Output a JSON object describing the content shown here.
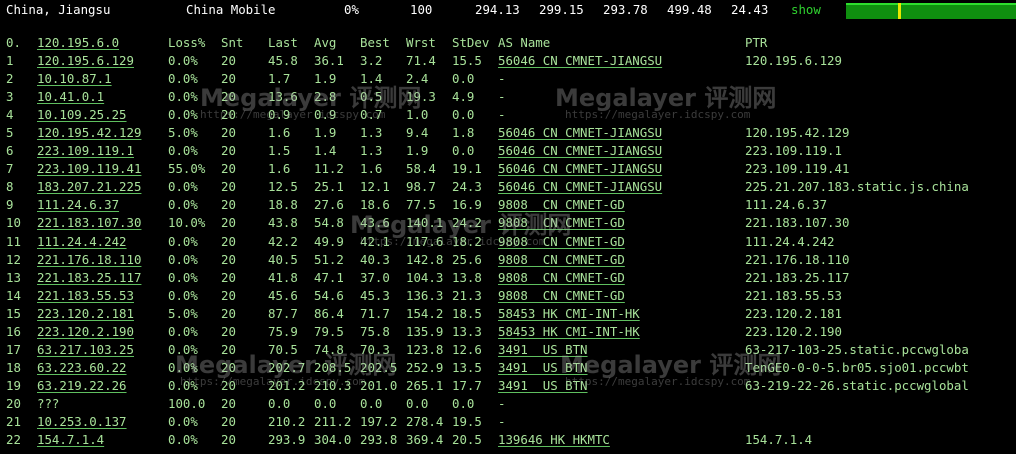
{
  "header": {
    "location": "China, Jiangsu",
    "isp": "China Mobile",
    "loss": "0%",
    "sent": "100",
    "last": "294.13",
    "avg": "299.15",
    "best": "293.78",
    "worst": "499.48",
    "stdev": "24.43",
    "show_label": "show",
    "bar_color": "#0f8f0f",
    "bar_spike_color": "#e8e800"
  },
  "columns": {
    "idx": "0.",
    "host": "120.195.6.0",
    "loss": "Loss%",
    "snt": "Snt",
    "last": "Last",
    "avg": "Avg",
    "best": "Best",
    "wrst": "Wrst",
    "stdev": "StDev",
    "as": "AS Name",
    "ptr": "PTR"
  },
  "rows": [
    {
      "n": "1",
      "host": "120.195.6.129",
      "loss": "0.0%",
      "snt": "20",
      "last": "45.8",
      "avg": "36.1",
      "best": "3.2",
      "wrst": "71.4",
      "stdev": "15.5",
      "as": "56046 CN CMNET-JIANGSU",
      "ptr": "120.195.6.129"
    },
    {
      "n": "2",
      "host": "10.10.87.1",
      "loss": "0.0%",
      "snt": "20",
      "last": "1.7",
      "avg": "1.9",
      "best": "1.4",
      "wrst": "2.4",
      "stdev": "0.0",
      "as": "-",
      "ptr": ""
    },
    {
      "n": "3",
      "host": "10.41.0.1",
      "loss": "0.0%",
      "snt": "20",
      "last": "13.6",
      "avg": "2.8",
      "best": "0.5",
      "wrst": "19.3",
      "stdev": "4.9",
      "as": "-",
      "ptr": ""
    },
    {
      "n": "4",
      "host": "10.109.25.25",
      "loss": "0.0%",
      "snt": "20",
      "last": "0.9",
      "avg": "0.9",
      "best": "0.7",
      "wrst": "1.0",
      "stdev": "0.0",
      "as": "-",
      "ptr": ""
    },
    {
      "n": "5",
      "host": "120.195.42.129",
      "loss": "5.0%",
      "snt": "20",
      "last": "1.6",
      "avg": "1.9",
      "best": "1.3",
      "wrst": "9.4",
      "stdev": "1.8",
      "as": "56046 CN CMNET-JIANGSU",
      "ptr": "120.195.42.129"
    },
    {
      "n": "6",
      "host": "223.109.119.1",
      "loss": "0.0%",
      "snt": "20",
      "last": "1.5",
      "avg": "1.4",
      "best": "1.3",
      "wrst": "1.9",
      "stdev": "0.0",
      "as": "56046 CN CMNET-JIANGSU",
      "ptr": "223.109.119.1"
    },
    {
      "n": "7",
      "host": "223.109.119.41",
      "loss": "55.0%",
      "snt": "20",
      "last": "1.6",
      "avg": "11.2",
      "best": "1.6",
      "wrst": "58.4",
      "stdev": "19.1",
      "as": "56046 CN CMNET-JIANGSU",
      "ptr": "223.109.119.41"
    },
    {
      "n": "8",
      "host": "183.207.21.225",
      "loss": "0.0%",
      "snt": "20",
      "last": "12.5",
      "avg": "25.1",
      "best": "12.1",
      "wrst": "98.7",
      "stdev": "24.3",
      "as": "56046 CN CMNET-JIANGSU",
      "ptr": "225.21.207.183.static.js.china"
    },
    {
      "n": "9",
      "host": "111.24.6.37",
      "loss": "0.0%",
      "snt": "20",
      "last": "18.8",
      "avg": "27.6",
      "best": "18.6",
      "wrst": "77.5",
      "stdev": "16.9",
      "as": "9808  CN CMNET-GD",
      "ptr": "111.24.6.37"
    },
    {
      "n": "10",
      "host": "221.183.107.30",
      "loss": "10.0%",
      "snt": "20",
      "last": "43.8",
      "avg": "54.8",
      "best": "43.6",
      "wrst": "140.1",
      "stdev": "24.2",
      "as": "9808  CN CMNET-GD",
      "ptr": "221.183.107.30"
    },
    {
      "n": "11",
      "host": "111.24.4.242",
      "loss": "0.0%",
      "snt": "20",
      "last": "42.2",
      "avg": "49.9",
      "best": "42.1",
      "wrst": "117.6",
      "stdev": "18.2",
      "as": "9808  CN CMNET-GD",
      "ptr": "111.24.4.242"
    },
    {
      "n": "12",
      "host": "221.176.18.110",
      "loss": "0.0%",
      "snt": "20",
      "last": "40.5",
      "avg": "51.2",
      "best": "40.3",
      "wrst": "142.8",
      "stdev": "25.6",
      "as": "9808  CN CMNET-GD",
      "ptr": "221.176.18.110"
    },
    {
      "n": "13",
      "host": "221.183.25.117",
      "loss": "0.0%",
      "snt": "20",
      "last": "41.8",
      "avg": "47.1",
      "best": "37.0",
      "wrst": "104.3",
      "stdev": "13.8",
      "as": "9808  CN CMNET-GD",
      "ptr": "221.183.25.117"
    },
    {
      "n": "14",
      "host": "221.183.55.53",
      "loss": "0.0%",
      "snt": "20",
      "last": "45.6",
      "avg": "54.6",
      "best": "45.3",
      "wrst": "136.3",
      "stdev": "21.3",
      "as": "9808  CN CMNET-GD",
      "ptr": "221.183.55.53"
    },
    {
      "n": "15",
      "host": "223.120.2.181",
      "loss": "5.0%",
      "snt": "20",
      "last": "87.7",
      "avg": "86.4",
      "best": "71.7",
      "wrst": "154.2",
      "stdev": "18.5",
      "as": "58453 HK CMI-INT-HK",
      "ptr": "223.120.2.181"
    },
    {
      "n": "16",
      "host": "223.120.2.190",
      "loss": "0.0%",
      "snt": "20",
      "last": "75.9",
      "avg": "79.5",
      "best": "75.8",
      "wrst": "135.9",
      "stdev": "13.3",
      "as": "58453 HK CMI-INT-HK",
      "ptr": "223.120.2.190"
    },
    {
      "n": "17",
      "host": "63.217.103.25",
      "loss": "0.0%",
      "snt": "20",
      "last": "70.5",
      "avg": "74.8",
      "best": "70.3",
      "wrst": "123.8",
      "stdev": "12.6",
      "as": "3491  US BTN",
      "ptr": "63-217-103-25.static.pccwgloba"
    },
    {
      "n": "18",
      "host": "63.223.60.22",
      "loss": "0.0%",
      "snt": "20",
      "last": "202.7",
      "avg": "208.5",
      "best": "202.5",
      "wrst": "252.9",
      "stdev": "13.5",
      "as": "3491  US BTN",
      "ptr": "TenGE0-0-0-5.br05.sjo01.pccwbt"
    },
    {
      "n": "19",
      "host": "63.219.22.26",
      "loss": "0.0%",
      "snt": "20",
      "last": "201.2",
      "avg": "210.3",
      "best": "201.0",
      "wrst": "265.1",
      "stdev": "17.7",
      "as": "3491  US BTN",
      "ptr": "63-219-22-26.static.pccwglobal"
    },
    {
      "n": "20",
      "host": "???",
      "loss": "100.0",
      "snt": "20",
      "last": "0.0",
      "avg": "0.0",
      "best": "0.0",
      "wrst": "0.0",
      "stdev": "0.0",
      "as": "-",
      "ptr": ""
    },
    {
      "n": "21",
      "host": "10.253.0.137",
      "loss": "0.0%",
      "snt": "20",
      "last": "210.2",
      "avg": "211.2",
      "best": "197.2",
      "wrst": "278.4",
      "stdev": "19.5",
      "as": "-",
      "ptr": ""
    },
    {
      "n": "22",
      "host": "154.7.1.4",
      "loss": "0.0%",
      "snt": "20",
      "last": "293.9",
      "avg": "304.0",
      "best": "293.8",
      "wrst": "369.4",
      "stdev": "20.5",
      "as": "139646 HK HKMTC",
      "ptr": "154.7.1.4"
    }
  ],
  "watermarks": {
    "brand": "Megalayer 评测网",
    "url": "https://megalayer.idcspy.com"
  }
}
